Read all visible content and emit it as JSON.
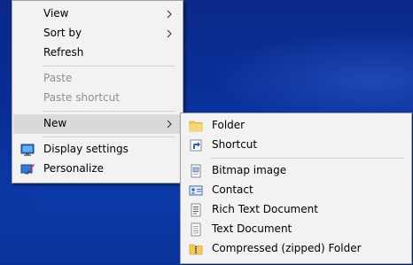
{
  "context_menu": {
    "items": [
      {
        "label": "View",
        "submenu": true
      },
      {
        "label": "Sort by",
        "submenu": true
      },
      {
        "label": "Refresh"
      },
      {
        "label": "Paste",
        "disabled": true
      },
      {
        "label": "Paste shortcut",
        "disabled": true
      },
      {
        "label": "New",
        "submenu": true,
        "highlighted": true
      },
      {
        "label": "Display settings",
        "icon": "display-icon"
      },
      {
        "label": "Personalize",
        "icon": "personalize-icon"
      }
    ]
  },
  "new_submenu": {
    "items": [
      {
        "label": "Folder",
        "icon": "folder-icon"
      },
      {
        "label": "Shortcut",
        "icon": "shortcut-icon"
      },
      {
        "label": "Bitmap image",
        "icon": "bitmap-icon"
      },
      {
        "label": "Contact",
        "icon": "contact-icon"
      },
      {
        "label": "Rich Text Document",
        "icon": "rtf-document-icon"
      },
      {
        "label": "Text Document",
        "icon": "text-document-icon"
      },
      {
        "label": "Compressed (zipped) Folder",
        "icon": "zip-folder-icon"
      }
    ]
  },
  "colors": {
    "desktop_background": "#0a2f99",
    "menu_background": "#f2f2f2",
    "menu_highlight": "#dadada",
    "disabled_text": "#8f8f8f"
  }
}
